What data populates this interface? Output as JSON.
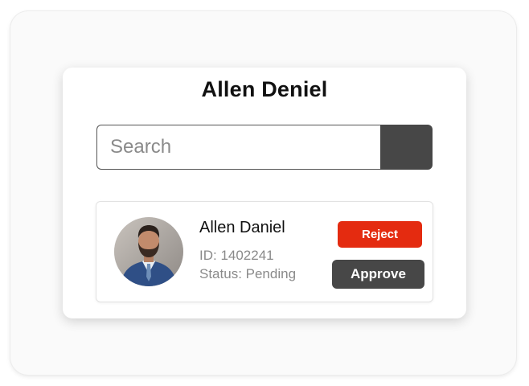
{
  "panel": {
    "title": "Allen Deniel"
  },
  "search": {
    "placeholder": "Search",
    "button_icon": "search-icon"
  },
  "request_card": {
    "name": "Allen Daniel",
    "id_text": "ID: 1402241",
    "status_text": "Status: Pending",
    "avatar": "profile-photo"
  },
  "actions": {
    "reject_label": "Reject",
    "approve_label": "Approve"
  },
  "colors": {
    "reject": "#e42b10",
    "approve": "#474747",
    "search_button": "#474747",
    "text_primary": "#111111",
    "text_secondary": "#8a8a8a"
  }
}
